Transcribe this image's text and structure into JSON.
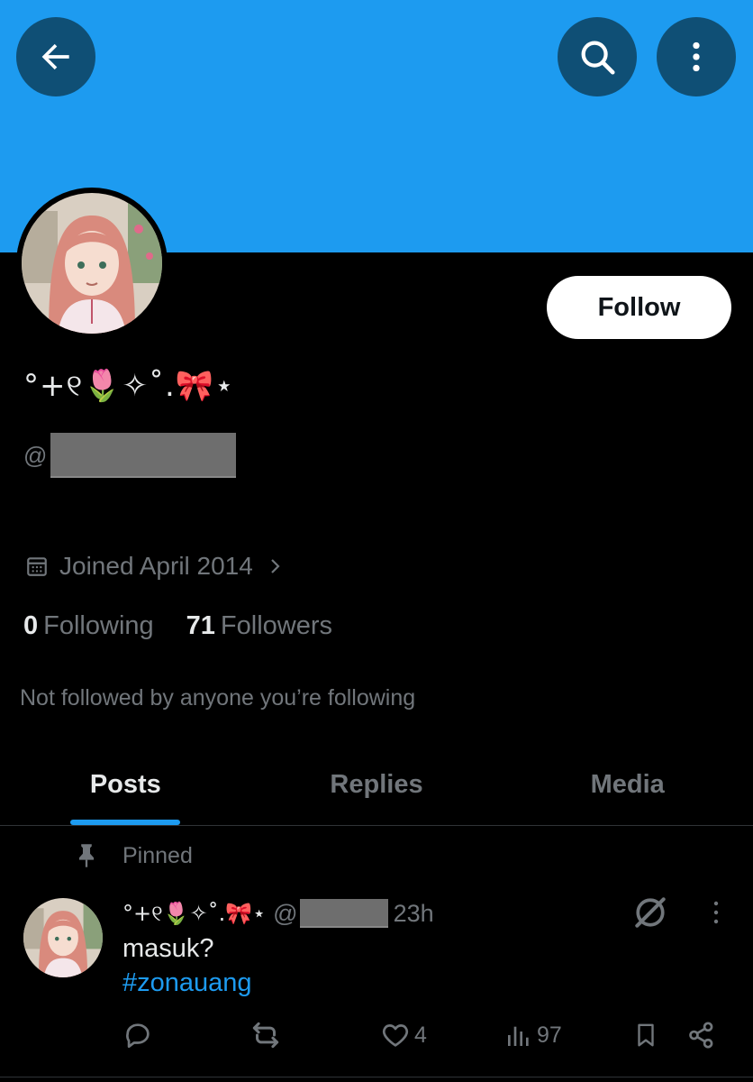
{
  "header": {
    "back_icon": "arrow-left-icon",
    "search_icon": "search-icon",
    "more_icon": "more-vertical-icon",
    "banner_color": "#1d9bf0"
  },
  "profile": {
    "display_name": "°+୧🌷✧˚.🎀⋆",
    "handle_prefix": "@",
    "follow_label": "Follow",
    "joined": "Joined April 2014",
    "following_count": "0",
    "following_label": "Following",
    "followers_count": "71",
    "followers_label": "Followers",
    "not_followed": "Not followed by anyone you’re following"
  },
  "tabs": [
    {
      "label": "Posts",
      "active": true
    },
    {
      "label": "Replies",
      "active": false
    },
    {
      "label": "Media",
      "active": false
    }
  ],
  "post": {
    "pinned_label": "Pinned",
    "author_name": "°+୧🌷✧˚.🎀⋆",
    "handle_prefix": "@",
    "time": "23h",
    "text": "masuk?",
    "hashtag": "#zonauang",
    "likes": "4",
    "views": "97"
  },
  "colors": {
    "accent": "#1d9bf0",
    "muted": "#71767b",
    "text": "#e7e9ea"
  }
}
